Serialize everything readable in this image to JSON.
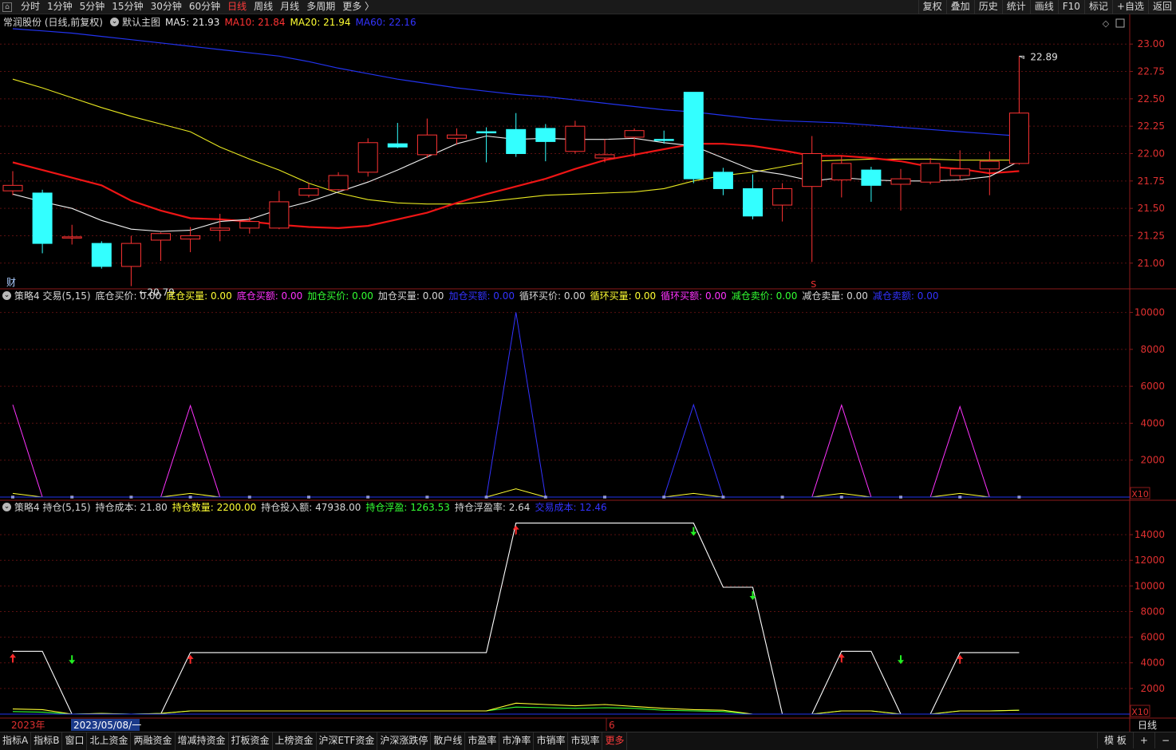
{
  "topbar": {
    "periods": [
      "分时",
      "1分钟",
      "5分钟",
      "15分钟",
      "30分钟",
      "60分钟",
      "日线",
      "周线",
      "月线",
      "多周期",
      "更多 〉"
    ],
    "active_period": "日线",
    "tools": [
      "复权",
      "叠加",
      "历史",
      "统计",
      "画线",
      "F10",
      "标记",
      "+自选",
      "返回"
    ]
  },
  "main_legend": {
    "stock": "常润股份 (日线,前复权)",
    "template": "默认主图",
    "ma5": "MA5: 21.93",
    "ma10": "MA10: 21.84",
    "ma20": "MA20: 21.94",
    "ma60": "MA60: 22.16"
  },
  "ind1_legend": {
    "name": "策略4 交易(5,15)",
    "items": [
      {
        "text": "底仓买价: 0.00",
        "color": "#d8d8d8"
      },
      {
        "text": "底仓买量: 0.00",
        "color": "#ffff33"
      },
      {
        "text": "底仓买额: 0.00",
        "color": "#ff33ff"
      },
      {
        "text": "加仓买价: 0.00",
        "color": "#33ff33"
      },
      {
        "text": "加仓买量: 0.00",
        "color": "#d8d8d8"
      },
      {
        "text": "加仓买额: 0.00",
        "color": "#3333ff"
      },
      {
        "text": "循环买价: 0.00",
        "color": "#d8d8d8"
      },
      {
        "text": "循环买量: 0.00",
        "color": "#ffff33"
      },
      {
        "text": "循环买额: 0.00",
        "color": "#ff33ff"
      },
      {
        "text": "减仓卖价: 0.00",
        "color": "#33ff33"
      },
      {
        "text": "减仓卖量: 0.00",
        "color": "#d8d8d8"
      },
      {
        "text": "减仓卖额: 0.00",
        "color": "#3333ff"
      }
    ]
  },
  "ind2_legend": {
    "name": "策略4 持仓(5,15)",
    "items": [
      {
        "text": "持仓成本: 21.80",
        "color": "#d8d8d8"
      },
      {
        "text": "持仓数量: 2200.00",
        "color": "#ffff33"
      },
      {
        "text": "持仓投入额: 47938.00",
        "color": "#d8d8d8"
      },
      {
        "text": "持仓浮盈: 1263.53",
        "color": "#33ff33"
      },
      {
        "text": "持仓浮盈率: 2.64",
        "color": "#d8d8d8"
      },
      {
        "text": "交易成本: 12.46",
        "color": "#3333ff"
      }
    ]
  },
  "labels": {
    "high": "22.89",
    "low": "←20.79",
    "cai": "财",
    "s_marker": "S",
    "x10": "X10",
    "year": "2023年",
    "date_cursor": "2023/05/08/一",
    "month6": "6",
    "axis_label": "日线"
  },
  "chart_data": {
    "type": "candlestick",
    "price_axis": {
      "ticks": [
        "23.00",
        "22.75",
        "22.50",
        "22.25",
        "22.00",
        "21.75",
        "21.50",
        "21.25",
        "21.00"
      ],
      "range": [
        20.78,
        23.14
      ]
    },
    "candles": [
      [
        21.66,
        21.71,
        21.84,
        21.62
      ],
      [
        21.64,
        21.18,
        21.67,
        21.09
      ],
      [
        21.24,
        21.24,
        21.35,
        21.17
      ],
      [
        21.18,
        20.97,
        21.2,
        20.95
      ],
      [
        20.97,
        21.18,
        21.25,
        20.79
      ],
      [
        21.21,
        21.27,
        21.28,
        21.02
      ],
      [
        21.22,
        21.25,
        21.33,
        21.1
      ],
      [
        21.3,
        21.32,
        21.45,
        21.2
      ],
      [
        21.32,
        21.38,
        21.42,
        21.27
      ],
      [
        21.32,
        21.56,
        21.66,
        21.31
      ],
      [
        21.62,
        21.68,
        21.73,
        21.6
      ],
      [
        21.67,
        21.8,
        21.83,
        21.66
      ],
      [
        21.83,
        22.1,
        22.14,
        21.79
      ],
      [
        22.09,
        22.06,
        22.28,
        22.05
      ],
      [
        21.99,
        22.17,
        22.32,
        21.96
      ],
      [
        22.14,
        22.17,
        22.23,
        22.08
      ],
      [
        22.2,
        22.19,
        22.24,
        21.92
      ],
      [
        22.22,
        22.0,
        22.37,
        21.97
      ],
      [
        22.23,
        22.11,
        22.27,
        21.93
      ],
      [
        22.02,
        22.25,
        22.3,
        22.0
      ],
      [
        21.96,
        21.99,
        22.13,
        21.92
      ],
      [
        22.15,
        22.21,
        22.23,
        21.97
      ],
      [
        22.13,
        22.12,
        22.21,
        22.09
      ],
      [
        22.56,
        21.77,
        22.56,
        21.73
      ],
      [
        21.83,
        21.68,
        21.87,
        21.62
      ],
      [
        21.68,
        21.43,
        21.81,
        21.4
      ],
      [
        21.53,
        21.68,
        21.73,
        21.38
      ],
      [
        21.7,
        22.0,
        22.16,
        21.01
      ],
      [
        21.76,
        21.91,
        21.98,
        21.6
      ],
      [
        21.85,
        21.71,
        21.88,
        21.56
      ],
      [
        21.72,
        21.77,
        21.86,
        21.48
      ],
      [
        21.74,
        21.91,
        21.96,
        21.72
      ],
      [
        21.8,
        21.86,
        22.03,
        21.76
      ],
      [
        21.86,
        21.93,
        22.02,
        21.62
      ],
      [
        21.91,
        22.37,
        22.89,
        21.9
      ]
    ],
    "ma5": [
      21.63,
      21.56,
      21.5,
      21.39,
      21.31,
      21.29,
      21.3,
      21.38,
      21.4,
      21.49,
      21.56,
      21.65,
      21.74,
      21.85,
      21.97,
      22.09,
      22.16,
      22.13,
      22.14,
      22.13,
      22.13,
      22.14,
      22.1,
      22.07,
      21.96,
      21.85,
      21.81,
      21.75,
      21.78,
      21.76,
      21.75,
      21.75,
      21.76,
      21.79,
      21.93
    ],
    "ma10": [
      21.92,
      21.85,
      21.78,
      21.71,
      21.57,
      21.48,
      21.41,
      21.4,
      21.38,
      21.35,
      21.33,
      21.32,
      21.34,
      21.4,
      21.46,
      21.55,
      21.63,
      21.7,
      21.77,
      21.86,
      21.94,
      21.99,
      22.04,
      22.09,
      22.09,
      22.07,
      22.03,
      21.98,
      21.98,
      21.96,
      21.93,
      21.88,
      21.86,
      21.82,
      21.84
    ],
    "ma20": [
      22.68,
      22.6,
      22.51,
      22.42,
      22.34,
      22.27,
      22.2,
      22.06,
      21.95,
      21.85,
      21.73,
      21.64,
      21.58,
      21.55,
      21.54,
      21.54,
      21.56,
      21.59,
      21.62,
      21.63,
      21.64,
      21.65,
      21.68,
      21.75,
      21.8,
      21.83,
      21.88,
      21.93,
      21.94,
      21.95,
      21.95,
      21.95,
      21.94,
      21.94,
      21.94
    ],
    "ma60": [
      23.14,
      23.12,
      23.1,
      23.07,
      23.04,
      23.01,
      22.98,
      22.95,
      22.92,
      22.89,
      22.84,
      22.78,
      22.73,
      22.68,
      22.64,
      22.6,
      22.57,
      22.54,
      22.52,
      22.49,
      22.46,
      22.43,
      22.4,
      22.38,
      22.35,
      22.32,
      22.3,
      22.29,
      22.28,
      22.26,
      22.24,
      22.22,
      22.2,
      22.18,
      22.16
    ],
    "ind1_axis": {
      "ticks": [
        "10000",
        "8000",
        "6000",
        "4000",
        "2000"
      ],
      "range": [
        0,
        10500
      ]
    },
    "ind1_series": [
      {
        "name": "底仓买额",
        "color": "#ff33ff",
        "values": [
          5000,
          0,
          0,
          0,
          0,
          0,
          4950,
          0,
          0,
          0,
          0,
          0,
          0,
          0,
          0,
          0,
          0,
          0,
          0,
          0,
          0,
          0,
          0,
          0,
          0,
          0,
          0,
          0,
          4980,
          0,
          0,
          0,
          4900,
          0,
          0
        ]
      },
      {
        "name": "加仓买额",
        "color": "#3333ff",
        "values": [
          0,
          0,
          0,
          0,
          0,
          0,
          0,
          0,
          0,
          0,
          0,
          0,
          0,
          0,
          0,
          0,
          0,
          10000,
          0,
          0,
          0,
          0,
          0,
          5000,
          0,
          0,
          0,
          0,
          0,
          0,
          0,
          0,
          0,
          0,
          0
        ]
      },
      {
        "name": "量",
        "color": "#ffff33",
        "values": [
          200,
          0,
          0,
          0,
          0,
          0,
          200,
          0,
          0,
          0,
          0,
          0,
          0,
          0,
          0,
          0,
          0,
          450,
          0,
          0,
          0,
          0,
          0,
          200,
          0,
          0,
          0,
          0,
          200,
          0,
          0,
          0,
          200,
          0,
          0
        ]
      }
    ],
    "ind2_axis": {
      "ticks": [
        "14000",
        "12000",
        "10000",
        "8000",
        "6000",
        "4000",
        "2000"
      ],
      "range": [
        0,
        15500
      ]
    },
    "ind2_series": [
      {
        "name": "持仓投入额",
        "color": "#ffffff",
        "values": [
          4900,
          4900,
          0,
          0,
          0,
          0,
          4800,
          4800,
          4800,
          4800,
          4800,
          4800,
          4800,
          4800,
          4800,
          4800,
          4800,
          14900,
          14900,
          14900,
          14900,
          14900,
          14900,
          14900,
          9900,
          9900,
          0,
          0,
          4900,
          4900,
          0,
          0,
          4800,
          4800,
          4800
        ]
      },
      {
        "name": "持仓浮盈",
        "color": "#33ff33",
        "values": [
          200,
          150,
          0,
          50,
          0,
          50,
          250,
          250,
          250,
          250,
          250,
          250,
          250,
          250,
          250,
          250,
          250,
          550,
          500,
          450,
          500,
          450,
          300,
          250,
          200,
          0,
          0,
          0,
          250,
          250,
          0,
          0,
          250,
          250,
          300
        ]
      },
      {
        "name": "持仓数量",
        "color": "#ffff33",
        "values": [
          400,
          350,
          0,
          50,
          0,
          50,
          250,
          250,
          250,
          250,
          250,
          250,
          250,
          250,
          250,
          250,
          250,
          850,
          750,
          650,
          750,
          600,
          450,
          350,
          300,
          0,
          0,
          0,
          250,
          250,
          0,
          0,
          250,
          250,
          300
        ]
      }
    ],
    "buy_markers": [
      0,
      6,
      17,
      28,
      32
    ],
    "sell_markers": [
      2,
      23,
      25,
      30
    ]
  }
}
